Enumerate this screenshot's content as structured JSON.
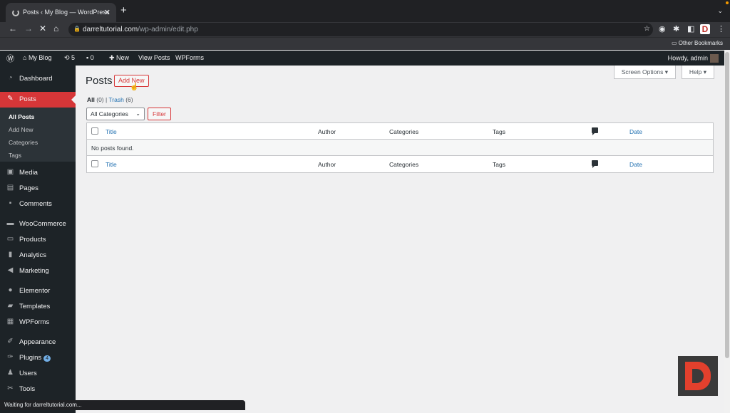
{
  "browser": {
    "tab_title": "Posts ‹ My Blog — WordPress",
    "url_domain": "darreltutorial.com",
    "url_path": "/wp-admin/edit.php",
    "bookmarks_label": "Other Bookmarks",
    "status_text": "Waiting for darreltutorial.com..."
  },
  "adminbar": {
    "site_name": "My Blog",
    "updates_count": "5",
    "comments_count": "0",
    "new_label": "New",
    "view_posts": "View Posts",
    "wpforms": "WPForms",
    "greeting": "Howdy, admin"
  },
  "sidebar": {
    "items": [
      {
        "label": "Dashboard",
        "icon": "dashboard-icon"
      },
      {
        "label": "Posts",
        "icon": "pin-icon"
      },
      {
        "label": "Media",
        "icon": "media-icon"
      },
      {
        "label": "Pages",
        "icon": "pages-icon"
      },
      {
        "label": "Comments",
        "icon": "comment-icon"
      },
      {
        "label": "WooCommerce",
        "icon": "woocommerce-icon"
      },
      {
        "label": "Products",
        "icon": "products-icon"
      },
      {
        "label": "Analytics",
        "icon": "analytics-icon"
      },
      {
        "label": "Marketing",
        "icon": "megaphone-icon"
      },
      {
        "label": "Elementor",
        "icon": "elementor-icon"
      },
      {
        "label": "Templates",
        "icon": "folder-icon"
      },
      {
        "label": "WPForms",
        "icon": "wpforms-icon"
      },
      {
        "label": "Appearance",
        "icon": "brush-icon"
      },
      {
        "label": "Plugins",
        "icon": "plug-icon",
        "badge": "4"
      },
      {
        "label": "Users",
        "icon": "user-icon"
      },
      {
        "label": "Tools",
        "icon": "wrench-icon"
      }
    ],
    "submenu": [
      "All Posts",
      "Add New",
      "Categories",
      "Tags"
    ]
  },
  "main": {
    "screen_options": "Screen Options",
    "help": "Help",
    "page_title": "Posts",
    "add_new": "Add New",
    "view_all": "All",
    "view_all_count": "(0)",
    "view_trash": "Trash",
    "view_trash_count": "(6)",
    "category_filter": "All Categories",
    "filter_button": "Filter",
    "columns": {
      "title": "Title",
      "author": "Author",
      "categories": "Categories",
      "tags": "Tags",
      "date": "Date"
    },
    "empty_message": "No posts found."
  },
  "colors": {
    "accent": "#d63638",
    "link": "#2271b1",
    "sidebar": "#1d2327"
  }
}
